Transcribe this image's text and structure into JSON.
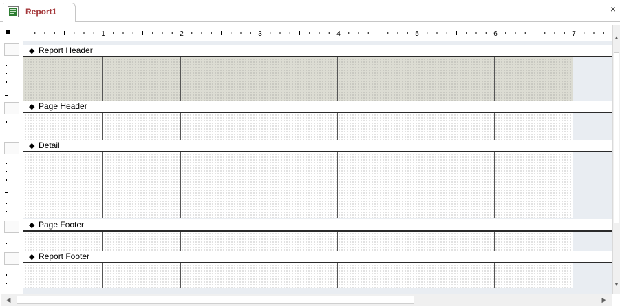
{
  "tab": {
    "title": "Report1",
    "icon": "report-icon",
    "close_glyph": "×"
  },
  "ruler": {
    "labels": [
      "1",
      "2",
      "3",
      "4",
      "5",
      "6",
      "7"
    ],
    "unit": "inches"
  },
  "sections": [
    {
      "id": "report-header",
      "label": "Report Header",
      "arrow": "◆",
      "shaded": true
    },
    {
      "id": "page-header",
      "label": "Page Header",
      "arrow": "◆",
      "shaded": false
    },
    {
      "id": "detail",
      "label": "Detail",
      "arrow": "◆",
      "shaded": false
    },
    {
      "id": "page-footer",
      "label": "Page Footer",
      "arrow": "◆",
      "shaded": false
    },
    {
      "id": "report-footer",
      "label": "Report Footer",
      "arrow": "◆",
      "shaded": false
    }
  ],
  "colors": {
    "tab_title": "#a4373a",
    "report_header_fill": "#dcdcd3",
    "canvas_bg": "#e9edf2"
  },
  "scrollbars": {
    "vertical_up": "▲",
    "vertical_down": "▼",
    "horizontal_left": "◀",
    "horizontal_right": "▶"
  }
}
